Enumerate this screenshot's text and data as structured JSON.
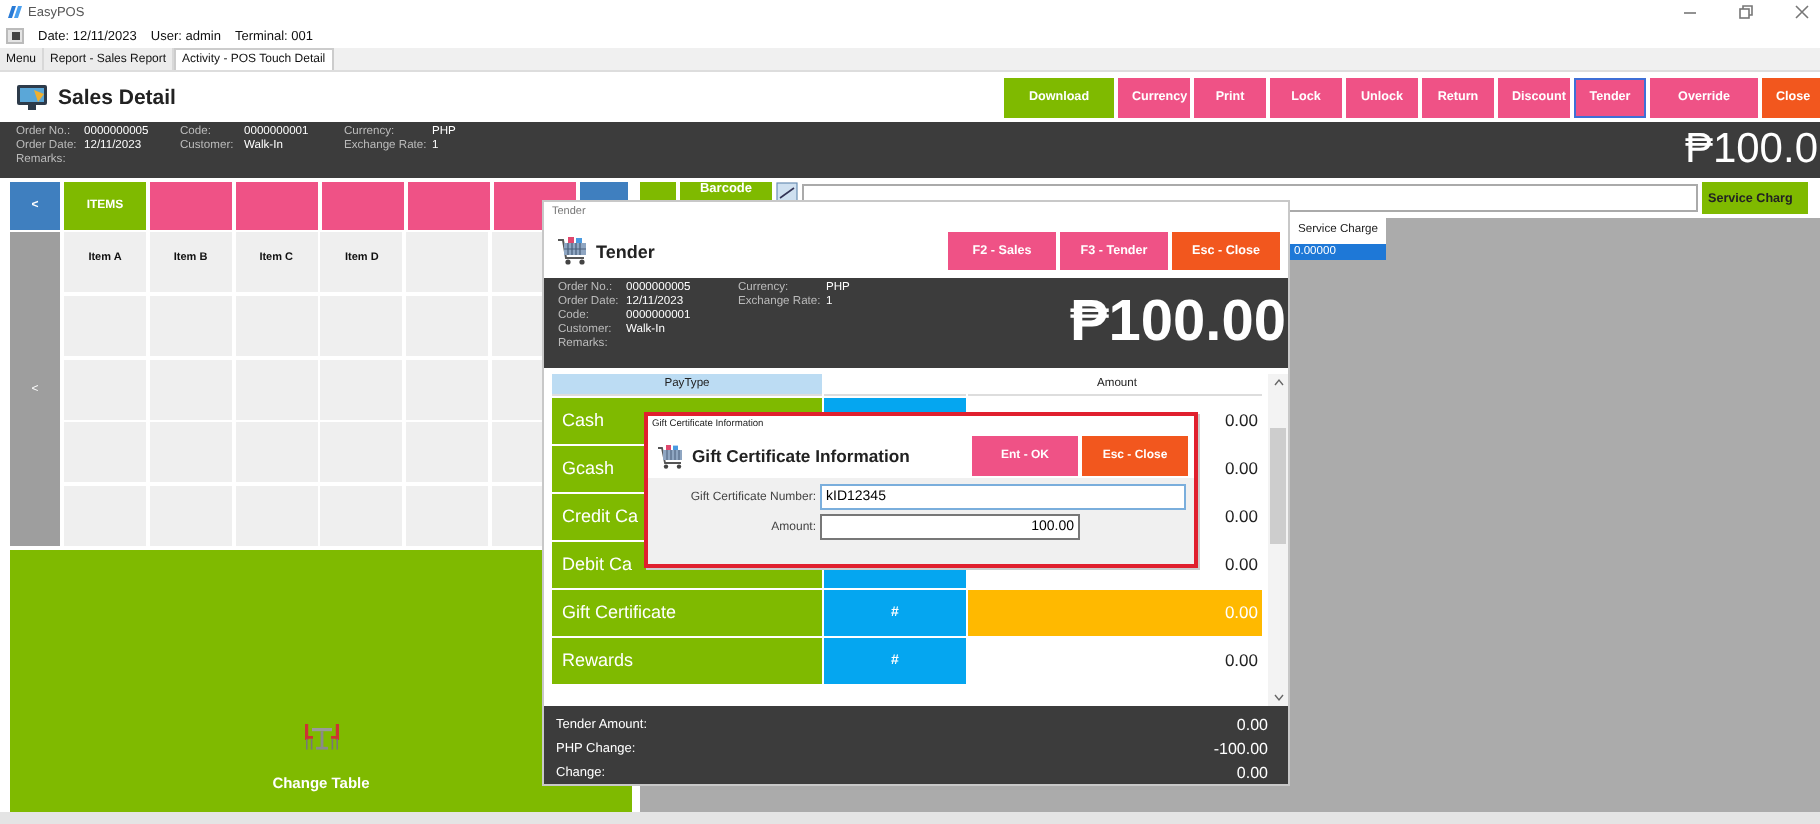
{
  "window": {
    "title": "EasyPOS"
  },
  "info_bar": {
    "date": "Date: 12/11/2023",
    "user": "User: admin",
    "terminal": "Terminal: 001"
  },
  "tabs": [
    {
      "label": "Menu",
      "selected": false
    },
    {
      "label": "Report - Sales Report",
      "selected": false
    },
    {
      "label": "Activity - POS Touch Detail",
      "selected": true
    }
  ],
  "sales_detail": {
    "title": "Sales Detail",
    "actions": [
      {
        "label": "Download",
        "kind": "go",
        "focused": false
      },
      {
        "label": "Currency",
        "kind": "normal",
        "focused": false
      },
      {
        "label": "Print",
        "kind": "normal",
        "focused": false
      },
      {
        "label": "Lock",
        "kind": "normal",
        "focused": false
      },
      {
        "label": "Unlock",
        "kind": "normal",
        "focused": false
      },
      {
        "label": "Return",
        "kind": "normal",
        "focused": false
      },
      {
        "label": "Discount",
        "kind": "normal",
        "focused": false
      },
      {
        "label": "Tender",
        "kind": "normal",
        "focused": true
      },
      {
        "label": "Override",
        "kind": "normal",
        "focused": false
      },
      {
        "label": "Close",
        "kind": "stop",
        "focused": false
      }
    ]
  },
  "order_info": {
    "columns": [
      [
        {
          "label": "Order No.:",
          "value": "0000000005"
        },
        {
          "label": "Order Date:",
          "value": "12/11/2023"
        },
        {
          "label": "Remarks:"
        }
      ],
      [
        {
          "label": "Code:",
          "value": "0000000001"
        },
        {
          "label": "Customer:",
          "value": "Walk-In"
        }
      ],
      [
        {
          "label": "Currency:",
          "value": "PHP"
        },
        {
          "label": "Exchange Rate:",
          "value": "1"
        }
      ]
    ],
    "total": "₱100.0"
  },
  "category_bar": [
    {
      "label": "<",
      "kind": "nav"
    },
    {
      "label": "ITEMS",
      "kind": "go"
    },
    {
      "kind": "normal"
    },
    {
      "kind": "normal"
    },
    {
      "kind": "normal"
    },
    {
      "kind": "normal"
    },
    {
      "kind": "normal"
    },
    {
      "kind": "nav"
    }
  ],
  "barcode_bar": {
    "button": "Barcode",
    "service_charge_button": "Service Charg"
  },
  "items": {
    "back": "<",
    "cells": [
      "Item A",
      "Item B",
      "Item C",
      "Item D"
    ]
  },
  "change_table": {
    "label": "Change Table"
  },
  "service_charge": {
    "header": "Service Charge",
    "rows": [
      {
        "value": "0.00000",
        "selected": true
      }
    ]
  },
  "tender_dialog": {
    "window_title": "Tender",
    "title": "Tender",
    "actions": [
      {
        "label": "F2 - Sales",
        "kind": "normal"
      },
      {
        "label": "F3 - Tender",
        "kind": "normal"
      },
      {
        "label": "Esc - Close",
        "kind": "stop"
      }
    ],
    "info": [
      [
        {
          "label": "Order No.:",
          "value": "0000000005"
        },
        {
          "label": "Order Date:",
          "value": "12/11/2023"
        },
        {
          "label": "Code:",
          "value": "0000000001"
        },
        {
          "label": "Customer:",
          "value": "Walk-In"
        },
        {
          "label": "Remarks:"
        }
      ],
      [
        {
          "label": "Currency:",
          "value": "PHP"
        },
        {
          "label": "Exchange Rate:",
          "value": "1"
        }
      ]
    ],
    "total": "₱100.00",
    "columns": {
      "pay_type": "PayType",
      "amount": "Amount"
    },
    "rows": [
      {
        "pay_type": "Cash",
        "amount": "0.00",
        "selected": false
      },
      {
        "pay_type": "Gcash",
        "amount": "0.00",
        "selected": false
      },
      {
        "pay_type": "Credit Ca",
        "amount": "0.00",
        "selected": false
      },
      {
        "pay_type": "Debit Ca",
        "amount": "0.00",
        "selected": false
      },
      {
        "pay_type": "Gift Certificate",
        "key": "#",
        "amount": "0.00",
        "selected": true
      },
      {
        "pay_type": "Rewards",
        "key": "#",
        "amount": "0.00",
        "selected": false
      }
    ],
    "summary": [
      {
        "label": "Tender Amount:",
        "value": "0.00"
      },
      {
        "label": "PHP Change:",
        "value": "-100.00"
      },
      {
        "label": "Change:",
        "value": "0.00"
      }
    ]
  },
  "gift_certificate_dialog": {
    "window_title": "Gift Certificate Information",
    "title": "Gift Certificate Information",
    "actions": [
      {
        "label": "Ent - OK",
        "kind": "normal"
      },
      {
        "label": "Esc - Close",
        "kind": "stop"
      }
    ],
    "fields": [
      {
        "label": "Gift Certificate Number:",
        "value": "kID12345",
        "kind": "text"
      },
      {
        "label": "Amount:",
        "value": "100.00",
        "kind": "number"
      }
    ]
  }
}
